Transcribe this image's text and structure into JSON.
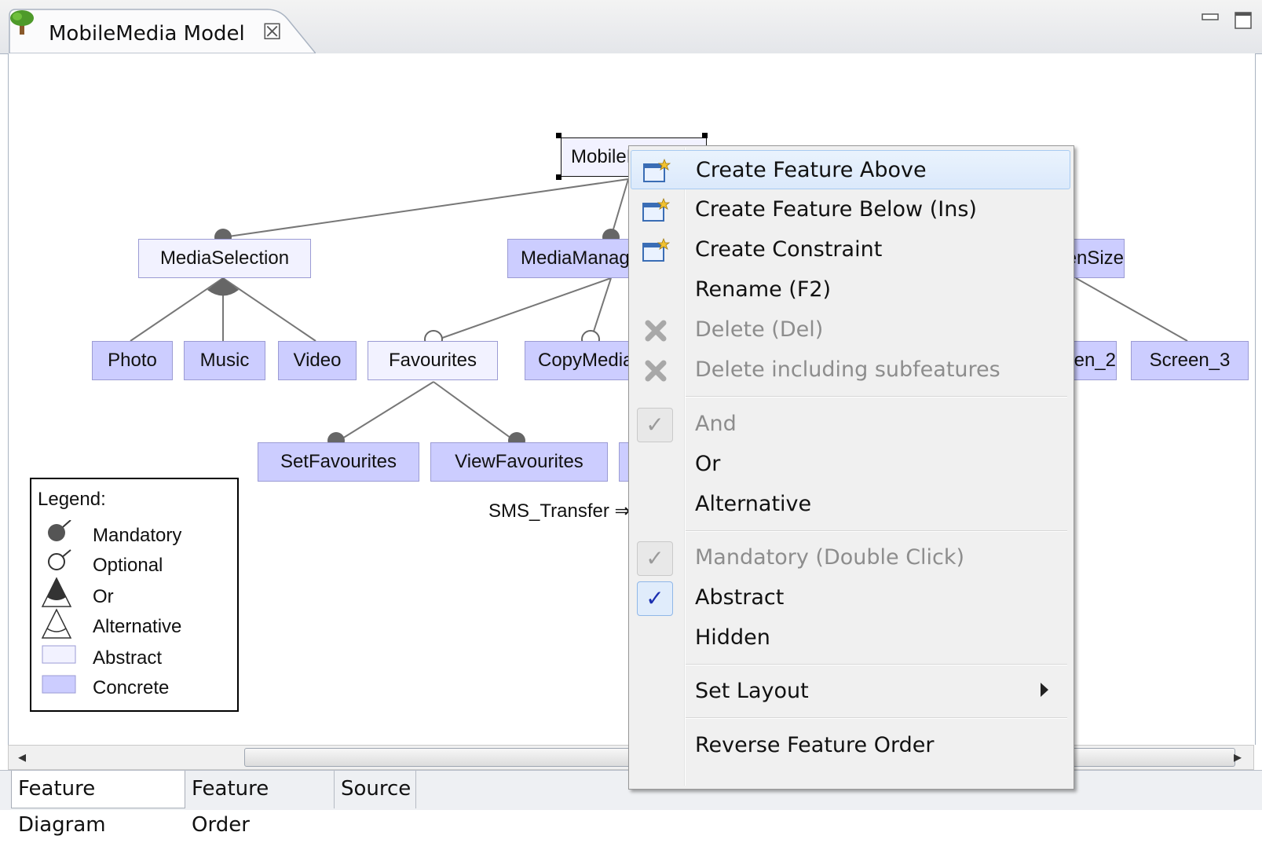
{
  "window": {
    "tab_title": "MobileMedia Model",
    "tab_close_glyph": "☒"
  },
  "diagram": {
    "features": {
      "root": "MobileMedia",
      "media_selection": "MediaSelection",
      "media_management": "MediaManagement",
      "screen_size": "ScreenSize",
      "photo": "Photo",
      "music": "Music",
      "video": "Video",
      "favourites": "Favourites",
      "copy_media": "CopyMedia",
      "screen_2": "Screen_2",
      "screen_3": "Screen_3",
      "set_favourites": "SetFavourites",
      "view_favourites": "ViewFavourites"
    },
    "constraint_text": "SMS_Transfer ⇒ CopyMedia"
  },
  "legend": {
    "title": "Legend:",
    "mandatory": "Mandatory",
    "optional": "Optional",
    "or": "Or",
    "alternative": "Alternative",
    "abstract": "Abstract",
    "concrete": "Concrete"
  },
  "context_menu": {
    "create_above": "Create Feature Above",
    "create_below": "Create Feature Below (Ins)",
    "create_constraint": "Create Constraint",
    "rename": "Rename (F2)",
    "delete": "Delete (Del)",
    "delete_sub": "Delete including subfeatures",
    "and": "And",
    "or": "Or",
    "alternative": "Alternative",
    "mandatory": "Mandatory (Double Click)",
    "abstract": "Abstract",
    "hidden": "Hidden",
    "set_layout": "Set Layout",
    "reverse_order": "Reverse Feature Order"
  },
  "bottom_tabs": {
    "feature_diagram": "Feature Diagram",
    "feature_order": "Feature Order",
    "source": "Source"
  },
  "colors": {
    "concrete": "#cccdff",
    "abstract": "#f2f2ff",
    "menu_bg": "#f0f0f0",
    "menu_hover": "#dbe9fb",
    "check_blue": "#1b2fb0"
  }
}
